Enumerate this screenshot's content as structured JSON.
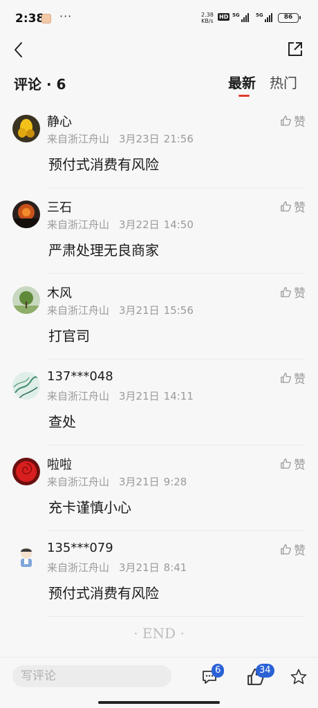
{
  "status_bar": {
    "time": "2:38",
    "net_speed_value": "2.38",
    "net_speed_unit": "KB/s",
    "hd_label": "HD",
    "signal1_label": "5G",
    "signal2_label": "5G",
    "battery": "86"
  },
  "header": {
    "title": "评论 · 6",
    "tabs": [
      {
        "label": "最新",
        "active": true
      },
      {
        "label": "热门",
        "active": false
      }
    ]
  },
  "comments": [
    {
      "author": "静心",
      "location": "来自浙江舟山",
      "date": "3月23日",
      "time": "21:56",
      "text": "预付式消费有风险",
      "like_label": "赞",
      "avatar": "yellow-flower"
    },
    {
      "author": "三石",
      "location": "来自浙江舟山",
      "date": "3月22日",
      "time": "14:50",
      "text": "严肃处理无良商家",
      "like_label": "赞",
      "avatar": "sunset"
    },
    {
      "author": "木风",
      "location": "来自浙江舟山",
      "date": "3月21日",
      "time": "15:56",
      "text": "打官司",
      "like_label": "赞",
      "avatar": "tree"
    },
    {
      "author": "137***048",
      "location": "来自浙江舟山",
      "date": "3月21日",
      "time": "14:11",
      "text": "查处",
      "like_label": "赞",
      "avatar": "bamboo"
    },
    {
      "author": "啦啦",
      "location": "来自浙江舟山",
      "date": "3月21日",
      "time": "9:28",
      "text": "充卡谨慎小心",
      "like_label": "赞",
      "avatar": "red-rose"
    },
    {
      "author": "135***079",
      "location": "来自浙江舟山",
      "date": "3月21日",
      "time": "8:41",
      "text": "预付式消费有风险",
      "like_label": "赞",
      "avatar": "cartoon-doctor"
    }
  ],
  "end_text": "·  END  ·",
  "bottom_bar": {
    "input_placeholder": "写评论",
    "comment_count": "6",
    "like_count": "34"
  },
  "colors": {
    "accent_red": "#e23c2b",
    "badge_blue": "#2a62d6",
    "meta_gray": "#9a9a9a"
  }
}
